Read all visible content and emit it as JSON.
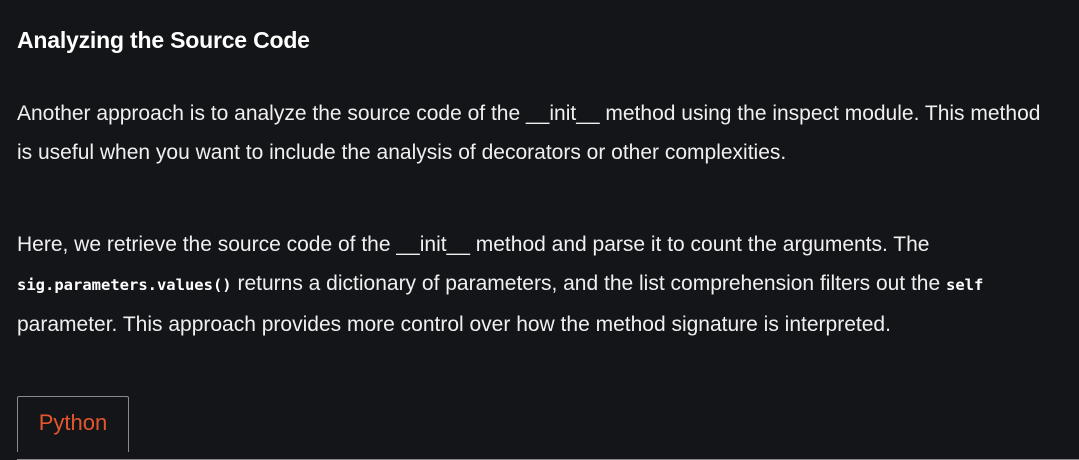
{
  "heading": "Analyzing the Source Code",
  "para1": {
    "text": "Another approach is to analyze the source code of the __init__ method using the inspect module. This method is useful when you want to include the analysis of decorators or other complexities."
  },
  "para2": {
    "part1": "Here, we retrieve the source code of the __init__ method and parse it to count the arguments. The ",
    "code1": "sig.parameters.values()",
    "part2": " returns a dictionary of parameters, and the list comprehension filters out the ",
    "code2": "self",
    "part3": " parameter. This approach provides more control over how the method signature is interpreted."
  },
  "tabs": [
    {
      "label": "Python",
      "active": true
    }
  ],
  "colors": {
    "background": "#141518",
    "text": "#f0f0f0",
    "tab_accent": "#e4572e",
    "border": "#8a8a8a"
  }
}
